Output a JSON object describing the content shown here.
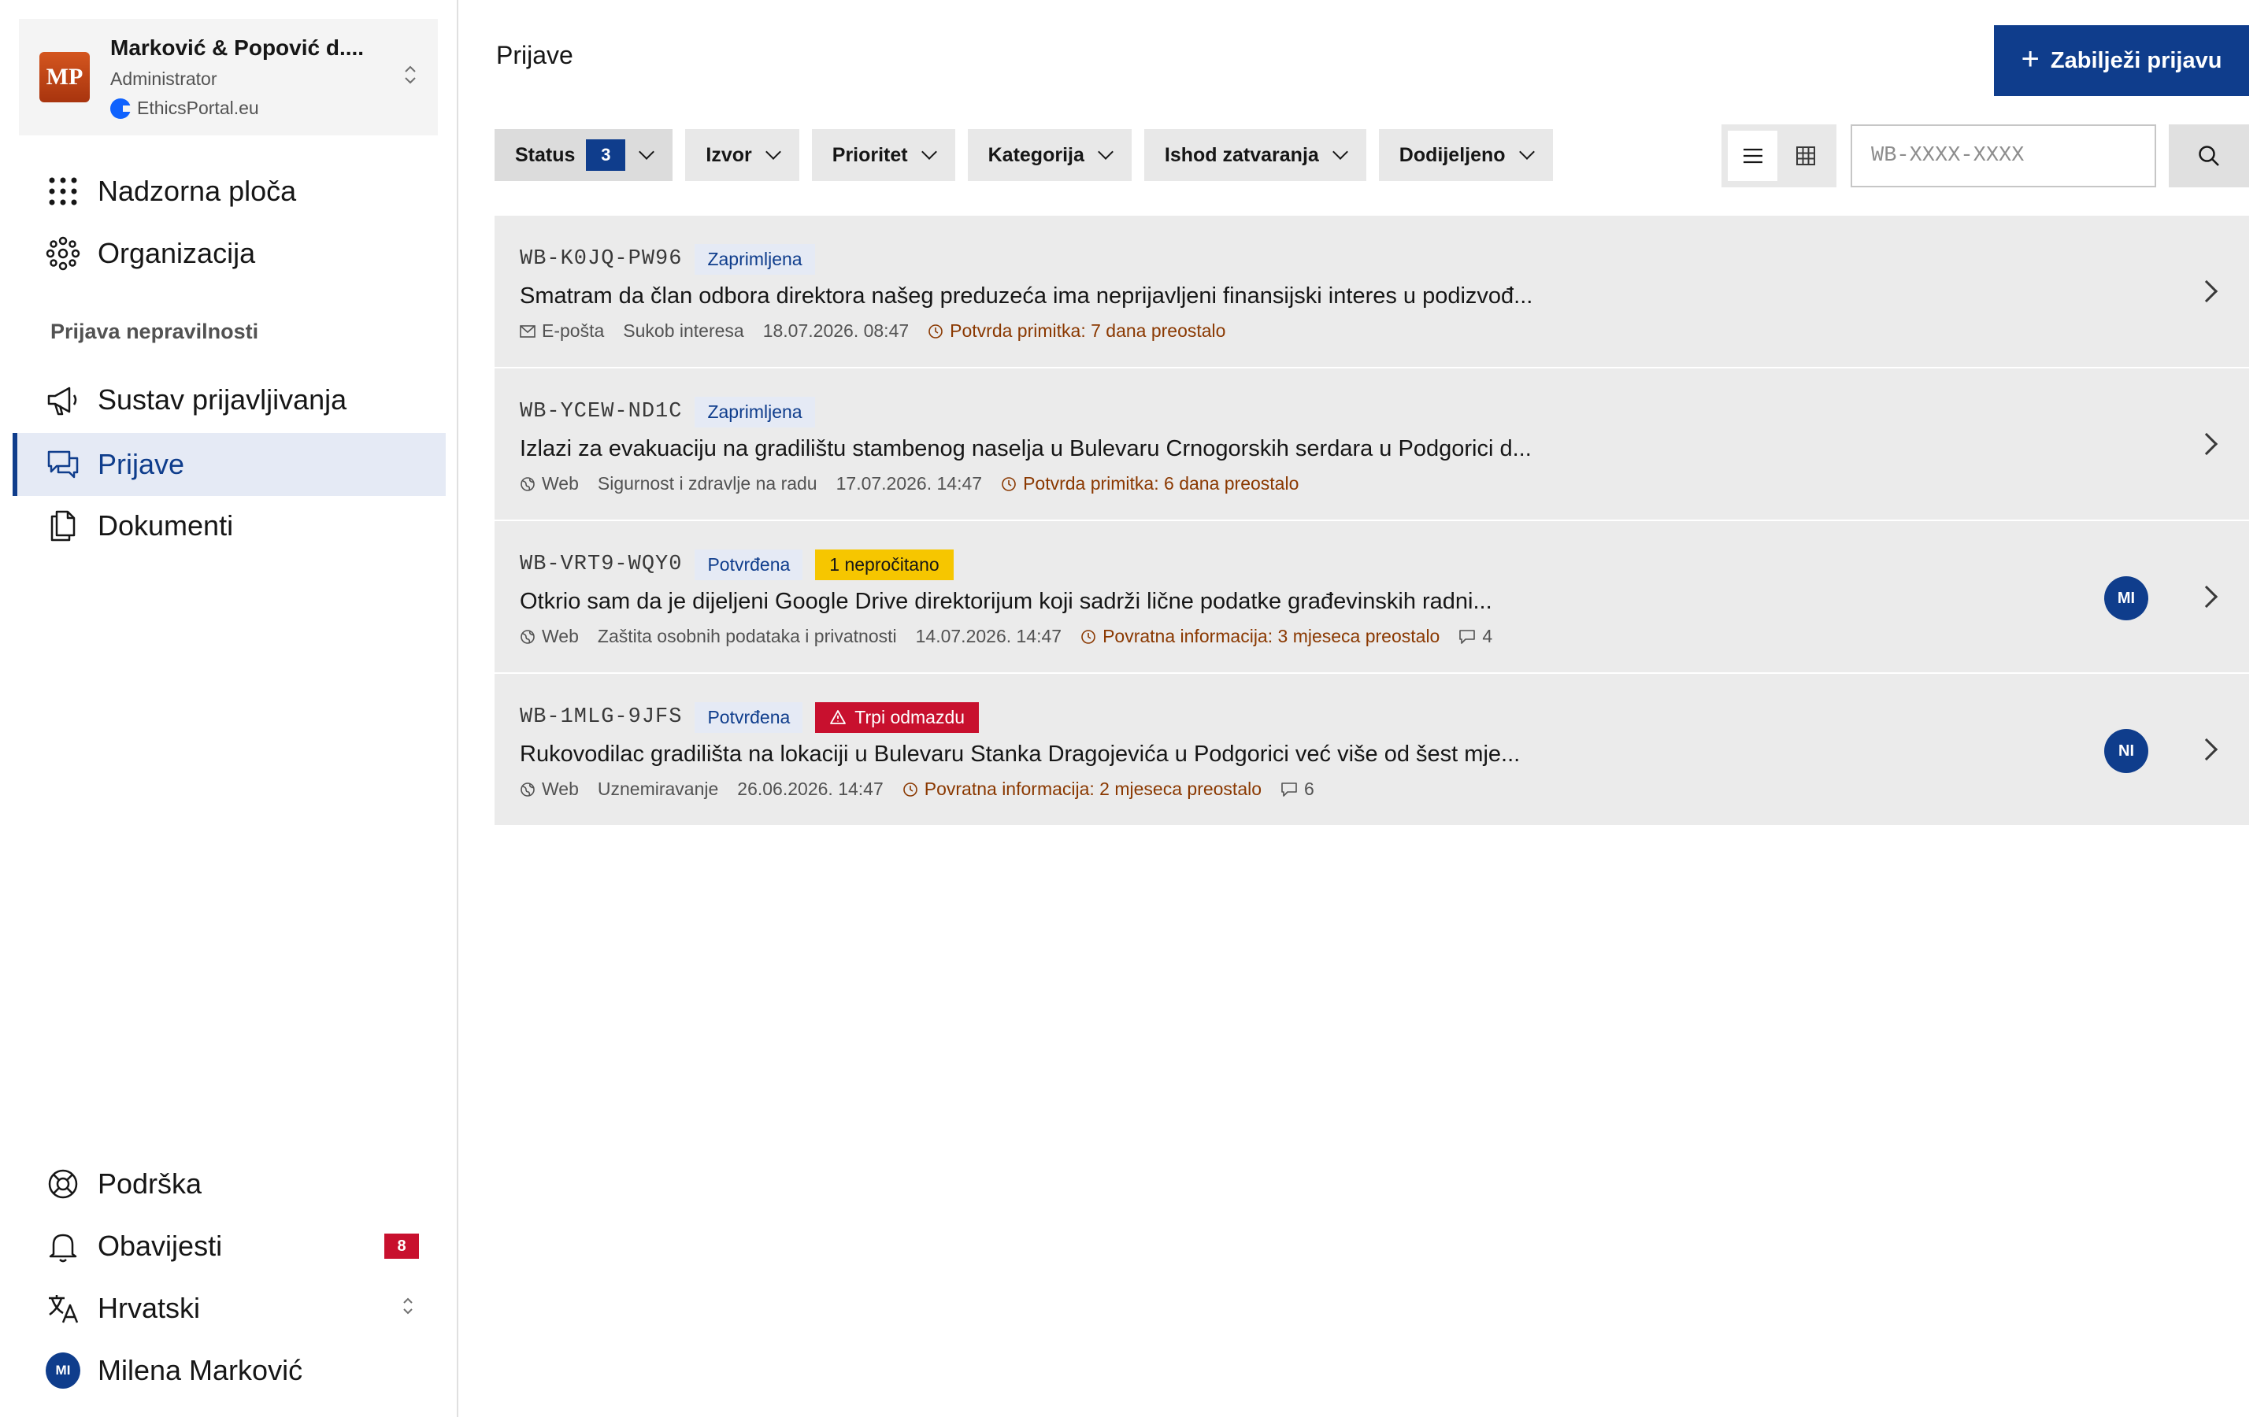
{
  "org": {
    "initials": "MP",
    "name": "Marković & Popović d....",
    "role": "Administrator",
    "portal": "EthicsPortal.eu"
  },
  "nav": {
    "dashboard": "Nadzorna ploča",
    "organization": "Organizacija",
    "section_label": "Prijava nepravilnosti",
    "reporting_system": "Sustav prijavljivanja",
    "reports": "Prijave",
    "documents": "Dokumenti",
    "support": "Podrška",
    "notifications": "Obavijesti",
    "notifications_count": "8",
    "language": "Hrvatski",
    "user_initials": "MI",
    "user_name": "Milena Marković"
  },
  "main": {
    "title": "Prijave",
    "new_button": "Zabilježi prijavu",
    "filters": {
      "status": "Status",
      "status_count": "3",
      "source": "Izvor",
      "priority": "Prioritet",
      "category": "Kategorija",
      "outcome": "Ishod zatvaranja",
      "assigned": "Dodijeljeno"
    },
    "search_placeholder": "WB-XXXX-XXXX"
  },
  "reports": [
    {
      "id": "WB-K0JQ-PW96",
      "status": "Zaprimljena",
      "title": "Smatram da član odbora direktora našeg preduzeća ima neprijavljeni finansijski interes u podizvođ...",
      "channel": "E-pošta",
      "category": "Sukob interesa",
      "date": "18.07.2026. 08:47",
      "deadline": "Potvrda primitka: 7 dana preostalo"
    },
    {
      "id": "WB-YCEW-ND1C",
      "status": "Zaprimljena",
      "title": "Izlazi za evakuaciju na gradilištu stambenog naselja u Bulevaru Crnogorskih serdara u Podgorici d...",
      "channel": "Web",
      "category": "Sigurnost i zdravlje na radu",
      "date": "17.07.2026. 14:47",
      "deadline": "Potvrda primitka: 6 dana preostalo"
    },
    {
      "id": "WB-VRT9-WQY0",
      "status": "Potvrđena",
      "unread": "1 nepročitano",
      "title": "Otkrio sam da je dijeljeni Google Drive direktorijum koji sadrži lične podatke građevinskih radni...",
      "channel": "Web",
      "category": "Zaštita osobnih podataka i privatnosti",
      "date": "14.07.2026. 14:47",
      "deadline": "Povratna informacija: 3 mjeseca preostalo",
      "comments": "4",
      "assignee": "MI"
    },
    {
      "id": "WB-1MLG-9JFS",
      "status": "Potvrđena",
      "alert": "Trpi odmazdu",
      "title": "Rukovodilac gradilišta na lokaciji u Bulevaru Stanka Dragojevića u Podgorici već više od šest mje...",
      "channel": "Web",
      "category": "Uznemiravanje",
      "date": "26.06.2026. 14:47",
      "deadline": "Povratna informacija: 2 mjeseca preostalo",
      "comments": "6",
      "assignee": "NI"
    }
  ],
  "colors": {
    "primary": "#0f3d8c",
    "danger": "#c8102e",
    "warning": "#f6c600",
    "deadline": "#8a3800"
  }
}
